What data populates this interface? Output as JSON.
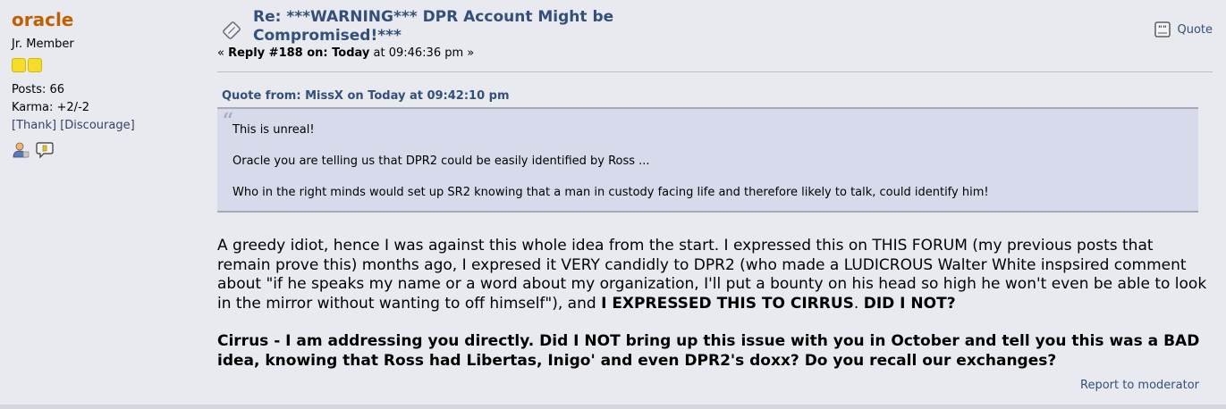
{
  "poster": {
    "name": "oracle",
    "group": "Jr. Member",
    "posts": "Posts: 66",
    "karma": "Karma: +2/-2",
    "thank": "[Thank]",
    "discourage": "[Discourage]"
  },
  "post": {
    "subject_line1": "Re: ***WARNING*** DPR Account Might be",
    "subject_line2": "Compromised!***",
    "reply_prefix": "« ",
    "reply_label": "Reply #188 on: Today",
    "reply_time": " at 09:46:36 pm »",
    "quote_button": "Quote",
    "report": "Report to moderator"
  },
  "quote": {
    "header": "Quote from: MissX on Today at 09:42:10 pm",
    "lines": [
      "This is unreal!",
      "Oracle you are telling us that DPR2 could be easily identified by Ross ...",
      "Who in the right minds would set up SR2 knowing that a man in custody facing life and therefore likely to talk, could identify him!"
    ]
  },
  "body": {
    "para1_text": "A greedy idiot, hence I was against this whole idea from the start. I expressed this on THIS FORUM (my previous posts that remain prove this) months ago, I expresed it VERY candidly to DPR2 (who made a LUDICROUS Walter White inspsired comment about \"if he speaks my name or a word about my organization, I'll put a bounty on his head so high he won't even be able to look in the mirror without wanting to off himself\"), and ",
    "para1_bold1": "I EXPRESSED THIS TO CIRRUS",
    "para1_mid": ". ",
    "para1_bold2": "DID I NOT?",
    "para2": "Cirrus - I am addressing you directly. Did I NOT bring up this issue with you in October and tell you this was a BAD idea, knowing that Ross had Libertas, Inigo' and even DPR2's doxx? Do you recall our exchanges?"
  },
  "colors": {
    "username": "#c06002",
    "link": "#33507a",
    "quote_bg": "#d7daeb",
    "page_bg": "#e8eaef"
  },
  "icons": [
    "star-icon",
    "profile-icon",
    "pm-icon",
    "subject-icon",
    "quote-icon"
  ]
}
